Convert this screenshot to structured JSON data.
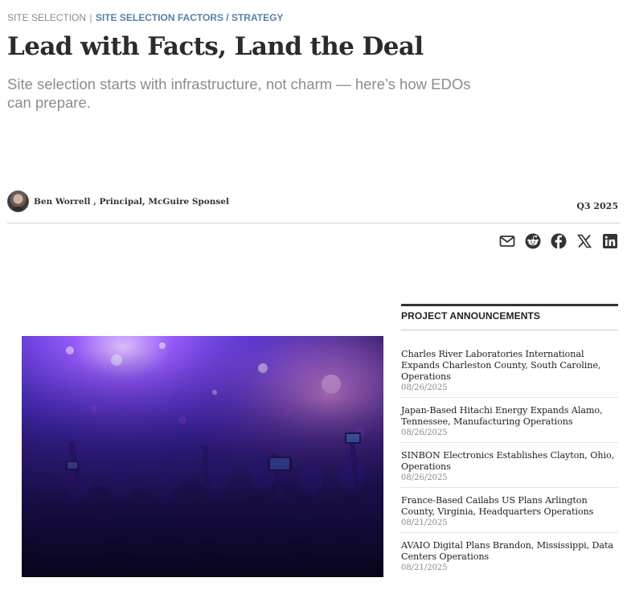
{
  "breadcrumb": {
    "section": "SITE SELECTION",
    "separator": "|",
    "category": "SITE SELECTION FACTORS / STRATEGY"
  },
  "article": {
    "title": "Lead with Facts, Land the Deal",
    "subtitle": "Site selection starts with infrastructure, not charm — here’s how EDOs can prepare.",
    "author": "Ben Worrell , Principal, McGuire Sponsel",
    "issue": "Q3 2025"
  },
  "share": {
    "icons": [
      "envelope-icon",
      "reddit-icon",
      "facebook-icon",
      "x-icon",
      "linkedin-icon"
    ]
  },
  "hero_image": {
    "subject": "concert crowd with raised phones under purple stage lights",
    "colors": {
      "deep": "#120c3a",
      "violet": "#6a3cff",
      "magenta": "#c34cff",
      "glow": "#ffd3f0"
    }
  },
  "sidebar": {
    "heading": "PROJECT ANNOUNCEMENTS",
    "items": [
      {
        "title": "Charles River Laboratories International Expands Charleston County, South Caroline, Operations",
        "date": "08/26/2025"
      },
      {
        "title": "Japan-Based Hitachi Energy Expands Alamo, Tennessee, Manufacturing Operations",
        "date": "08/26/2025"
      },
      {
        "title": "SINBON Electronics Establishes Clayton, Ohio, Operations",
        "date": "08/26/2025"
      },
      {
        "title": "France-Based Cailabs US Plans Arlington County, Virginia, Headquarters Operations",
        "date": "08/21/2025"
      },
      {
        "title": "AVAIO Digital Plans Brandon, Mississippi, Data Centers Operations",
        "date": "08/21/2025"
      }
    ]
  }
}
